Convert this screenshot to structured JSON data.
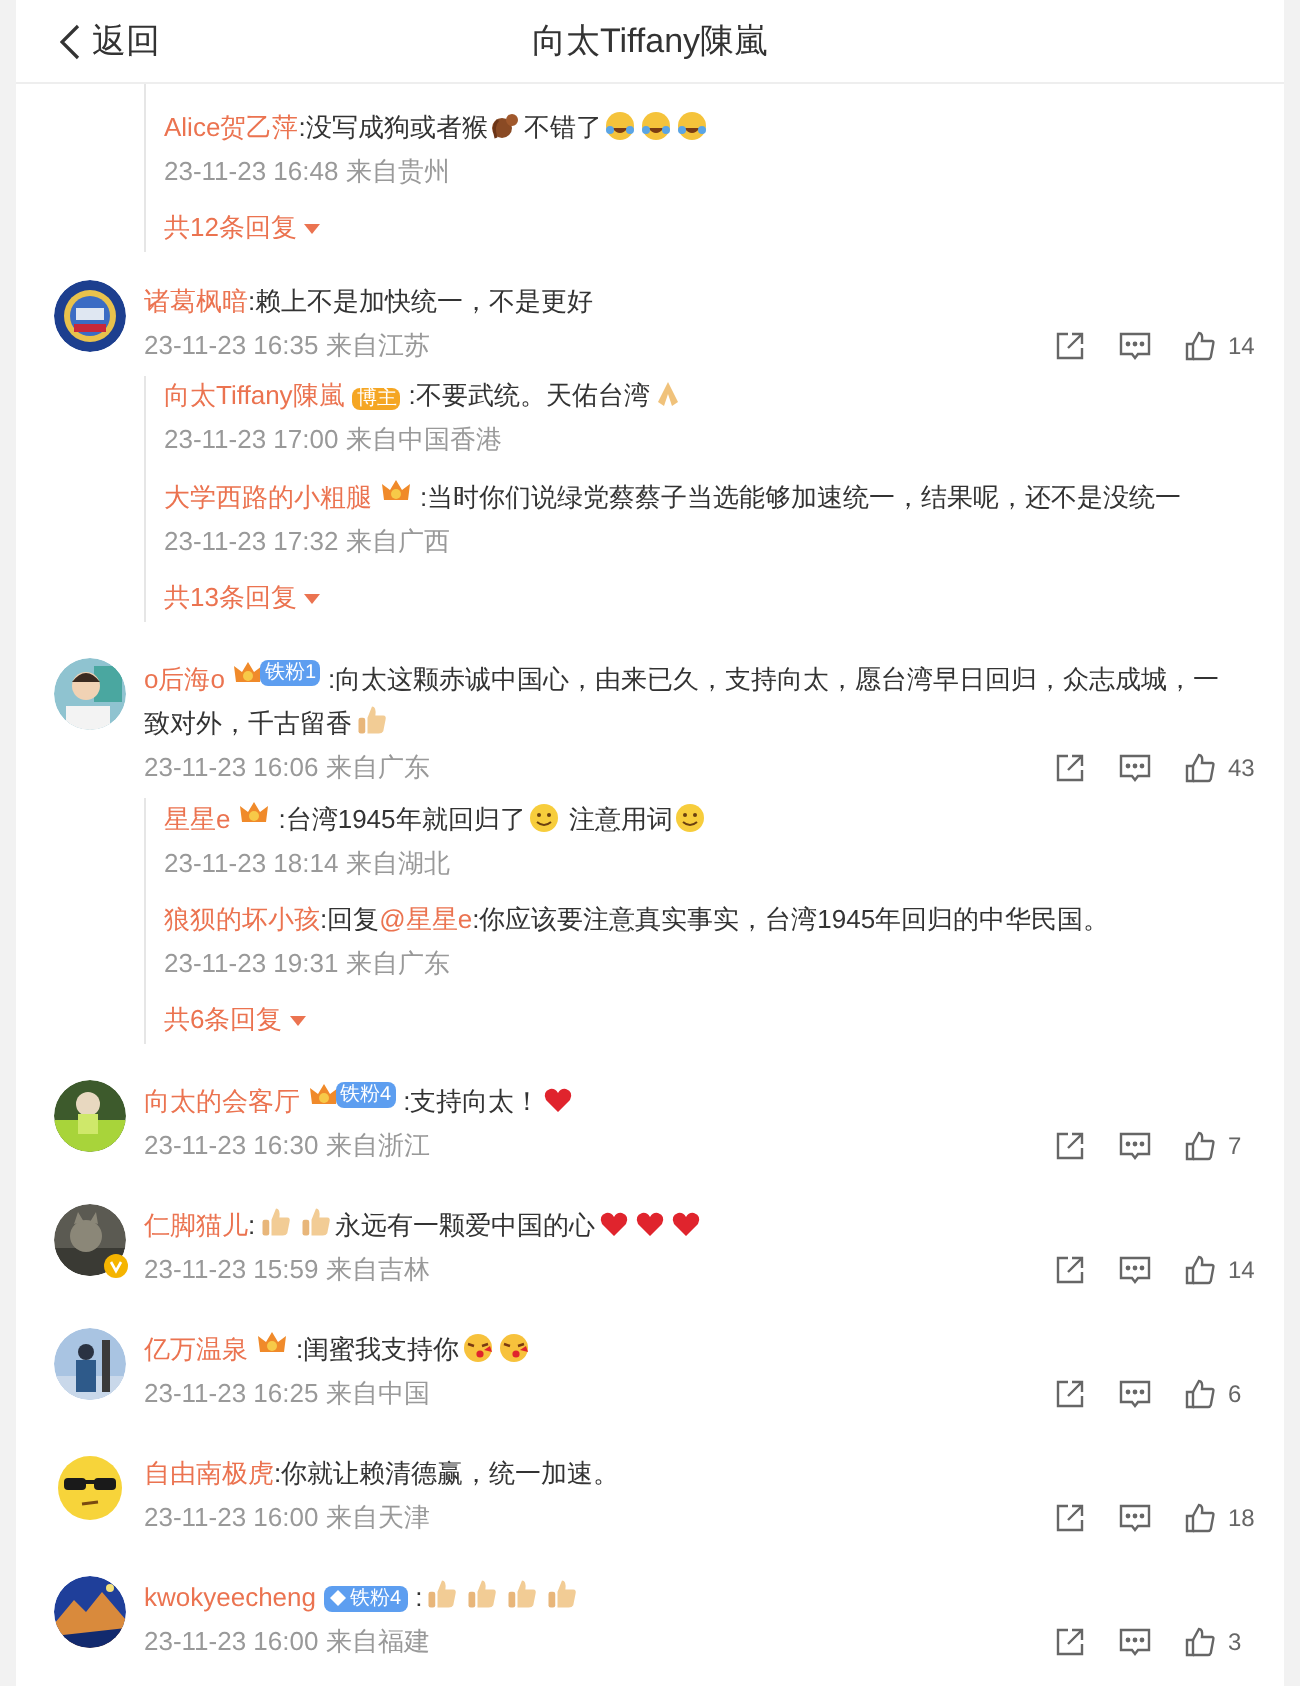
{
  "header": {
    "back": "返回",
    "title": "向太Tiffany陳嵐"
  },
  "top_thread": {
    "replies": [
      {
        "name": "Alice贺乙萍",
        "segments": [
          {
            "kind": "text",
            "text": ":没写成狗或者猴"
          },
          {
            "kind": "monkey"
          },
          {
            "kind": "text",
            "text": "不错了"
          },
          {
            "kind": "laugh"
          },
          {
            "kind": "laugh"
          },
          {
            "kind": "laugh"
          }
        ],
        "meta": "23-11-23 16:48 来自贵州"
      }
    ],
    "more": "共12条回复"
  },
  "comments": [
    {
      "name": "诸葛枫暗",
      "verified": false,
      "segments": [
        {
          "kind": "text",
          "text": ":赖上不是加快统一，不是更好"
        }
      ],
      "meta": "23-11-23 16:35 来自江苏",
      "likes": "14",
      "replies": [
        {
          "name": "向太Tiffany陳嵐",
          "badges": [
            {
              "kind": "author",
              "label": "博主"
            }
          ],
          "segments": [
            {
              "kind": "text",
              "text": ":不要武统。天佑台湾"
            },
            {
              "kind": "pray"
            }
          ],
          "meta": "23-11-23 17:00 来自中国香港"
        },
        {
          "name": "大学西路的小粗腿",
          "badges": [
            {
              "kind": "crown"
            }
          ],
          "segments": [
            {
              "kind": "text",
              "text": ":当时你们说绿党蔡蔡子当选能够加速统一，结果呢，还不是没统一"
            }
          ],
          "meta": "23-11-23 17:32 来自广西"
        }
      ],
      "more": "共13条回复"
    },
    {
      "name": "o后海o",
      "verified": false,
      "badges": [
        {
          "kind": "fan",
          "label": "铁粉1"
        }
      ],
      "segments": [
        {
          "kind": "text",
          "text": ":向太这颗赤诚中国心，由来已久，支持向太，愿台湾早日回归，众志成城，一致对外，千古留香"
        },
        {
          "kind": "thumbs"
        }
      ],
      "meta": "23-11-23 16:06 来自广东",
      "likes": "43",
      "replies": [
        {
          "name": "星星e",
          "badges": [
            {
              "kind": "crown"
            }
          ],
          "segments": [
            {
              "kind": "text",
              "text": ":台湾1945年就回归了"
            },
            {
              "kind": "smile"
            },
            {
              "kind": "text",
              "text": " 注意用词"
            },
            {
              "kind": "smile"
            }
          ],
          "meta": "23-11-23 18:14 来自湖北"
        },
        {
          "name": "狼狈的坏小孩",
          "segments": [
            {
              "kind": "text",
              "text": ":回复"
            },
            {
              "kind": "mention",
              "text": "@星星e"
            },
            {
              "kind": "text",
              "text": ":你应该要注意真实事实，台湾1945年回归的中华民国。"
            }
          ],
          "meta": "23-11-23 19:31 来自广东"
        }
      ],
      "more": "共6条回复"
    },
    {
      "name": "向太的会客厅",
      "verified": false,
      "badges": [
        {
          "kind": "fan",
          "label": "铁粉4"
        }
      ],
      "segments": [
        {
          "kind": "text",
          "text": ":支持向太！"
        },
        {
          "kind": "heart"
        }
      ],
      "meta": "23-11-23 16:30 来自浙江",
      "likes": "7"
    },
    {
      "name": "仁脚猫儿",
      "verified": true,
      "segments": [
        {
          "kind": "text",
          "text": ":"
        },
        {
          "kind": "thumbs"
        },
        {
          "kind": "thumbs"
        },
        {
          "kind": "text",
          "text": "永远有一颗爱中国的心"
        },
        {
          "kind": "heart"
        },
        {
          "kind": "heart"
        },
        {
          "kind": "heart"
        }
      ],
      "meta": "23-11-23 15:59 来自吉林",
      "likes": "14"
    },
    {
      "name": "亿万温泉",
      "verified": false,
      "badges": [
        {
          "kind": "crown"
        }
      ],
      "segments": [
        {
          "kind": "text",
          "text": ":闺蜜我支持你"
        },
        {
          "kind": "kiss"
        },
        {
          "kind": "kiss"
        }
      ],
      "meta": "23-11-23 16:25 来自中国",
      "likes": "6"
    },
    {
      "name": "自由南极虎",
      "verified": false,
      "segments": [
        {
          "kind": "text",
          "text": ":你就让赖清德赢，统一加速。"
        }
      ],
      "meta": "23-11-23 16:00 来自天津",
      "likes": "18"
    },
    {
      "name": "kwokyeecheng",
      "verified": false,
      "badges": [
        {
          "kind": "diamond",
          "label": "铁粉4"
        }
      ],
      "segments": [
        {
          "kind": "text",
          "text": ":"
        },
        {
          "kind": "thumbs"
        },
        {
          "kind": "thumbs"
        },
        {
          "kind": "thumbs"
        },
        {
          "kind": "thumbs"
        }
      ],
      "meta": "23-11-23 16:00 来自福建",
      "likes": "3"
    }
  ]
}
